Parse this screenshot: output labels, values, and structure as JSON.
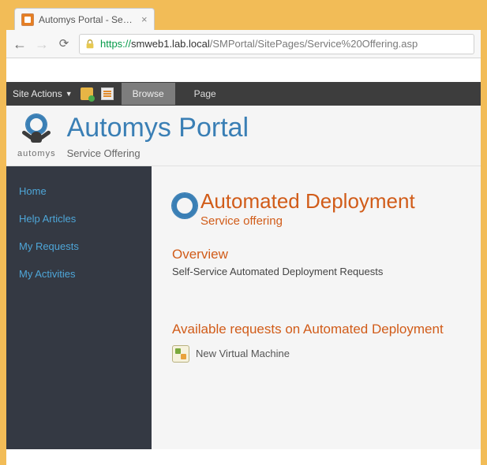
{
  "browser": {
    "tab_title": "Automys Portal - Service O",
    "url_proto": "https://",
    "url_host": "smweb1.lab.local",
    "url_path": "/SMPortal/SitePages/Service%20Offering.asp"
  },
  "ribbon": {
    "site_actions": "Site Actions",
    "browse": "Browse",
    "page": "Page"
  },
  "banner": {
    "logo_text": "automys",
    "title": "Automys Portal",
    "breadcrumb": "Service Offering"
  },
  "sidebar": {
    "items": [
      "Home",
      "Help Articles",
      "My Requests",
      "My Activities"
    ]
  },
  "content": {
    "title": "Automated Deployment",
    "subtitle": "Service offering",
    "overview_h": "Overview",
    "overview_p": "Self-Service Automated Deployment Requests",
    "available_h": "Available requests on Automated Deployment",
    "requests": [
      {
        "label": "New Virtual Machine"
      }
    ]
  }
}
